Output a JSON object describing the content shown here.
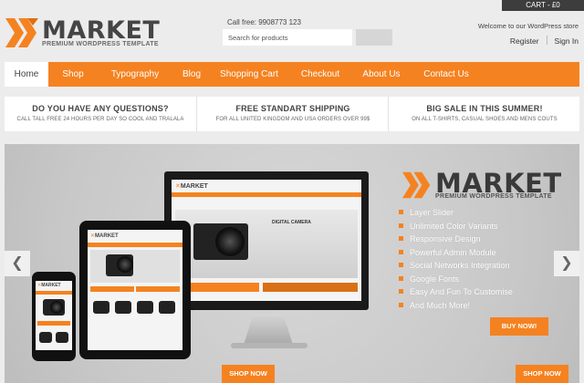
{
  "header": {
    "logo_word": "MARKET",
    "logo_tagline": "PREMIUM WORDPRESS TEMPLATE",
    "call": "Call free: 9908773 123",
    "search_placeholder": "Search for products",
    "cart": "CART - £0",
    "welcome": "Welcome to our WordPress store",
    "register": "Register",
    "sign_in": "Sign In"
  },
  "nav": {
    "items": [
      "Home",
      "Shop",
      "Typography",
      "Blog",
      "Shopping Cart",
      "Checkout",
      "About Us",
      "Contact Us"
    ],
    "active": "Home"
  },
  "info": [
    {
      "title": "DO YOU HAVE ANY QUESTIONS?",
      "sub": "CALL TALL FREE 24 HOURS PER DAY SO COOL AND TRALALA"
    },
    {
      "title": "FREE STANDART SHIPPING",
      "sub": "FOR ALL UNITED KINGDOM AND USA ORDERS OVER 99$"
    },
    {
      "title": "BIG SALE IN THIS SUMMER!",
      "sub": "ON ALL T-SHIRTS, CASUAL SHOES AND MENS COUTS"
    }
  ],
  "slider": {
    "logo_word": "MARKET",
    "logo_tagline": "PREMIUM WORDPRESS TEMPLATE",
    "features": [
      "Layer Slider",
      "Unlimited Color Variants",
      "Responsive Design",
      "Powerful Admin Module",
      "Social Networks Integration",
      "Google Fonts",
      "Easy And Fun To Customise",
      "And Much More!"
    ],
    "buy_now": "BUY NOW!",
    "shop_now_left": "SHOP NOW",
    "shop_now_right": "SHOP NOW",
    "screen_label": "DIGITAL CAMERA"
  },
  "colors": {
    "accent": "#f58220",
    "dark": "#3d3d3d",
    "background": "#ececec"
  },
  "icons": {
    "prev": "chevron-left-icon",
    "next": "chevron-right-icon",
    "logo": "x-logo-icon"
  }
}
